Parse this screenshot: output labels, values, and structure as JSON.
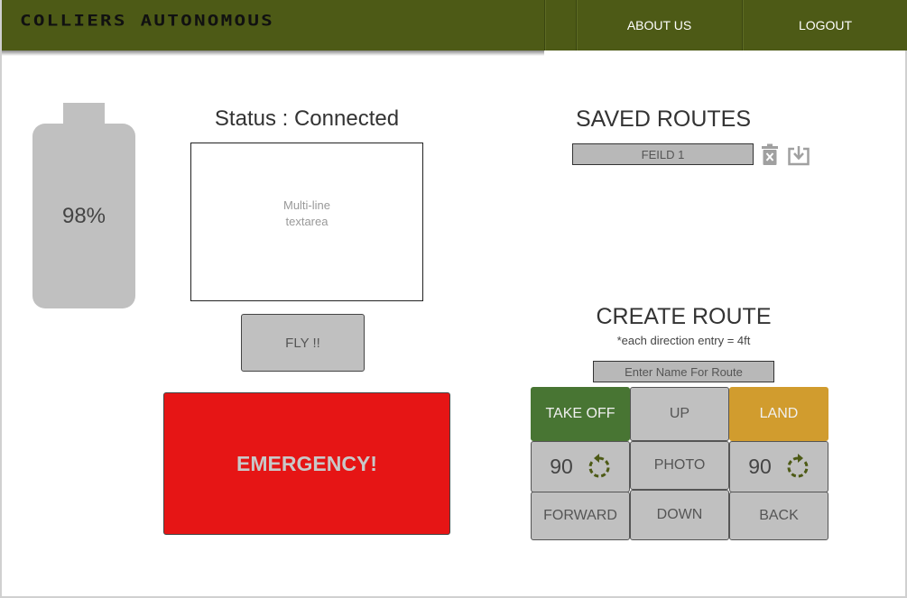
{
  "header": {
    "logo": "COLLIERS AUTONOMOUS",
    "nav": [
      {
        "label": "ABOUT US"
      },
      {
        "label": "LOGOUT"
      }
    ]
  },
  "battery": {
    "percent_label": "98%",
    "level": 0.98
  },
  "status": {
    "label": "Status : Connected",
    "textarea_placeholder": "Multi-line\ntextarea"
  },
  "controls": {
    "fly_label": "FLY !!",
    "emergency_label": "EMERGENCY!"
  },
  "saved_routes": {
    "title": "SAVED ROUTES",
    "items": [
      {
        "label": "FEILD 1"
      }
    ]
  },
  "create_route": {
    "title": "CREATE ROUTE",
    "note": "*each direction entry = 4ft",
    "name_placeholder": "Enter Name For Route",
    "buttons": {
      "take_off": "TAKE OFF",
      "up": "UP",
      "land": "LAND",
      "rotate_left_value": "90",
      "photo": "PHOTO",
      "rotate_right_value": "90",
      "forward": "FORWARD",
      "down": "DOWN",
      "back": "BACK"
    }
  },
  "colors": {
    "header": "#4d5a16",
    "emergency": "#e61515",
    "take_off": "#487533",
    "land": "#d19c2e",
    "button_gray": "#c0c0c0",
    "rotate_icon": "#4d5a16"
  }
}
